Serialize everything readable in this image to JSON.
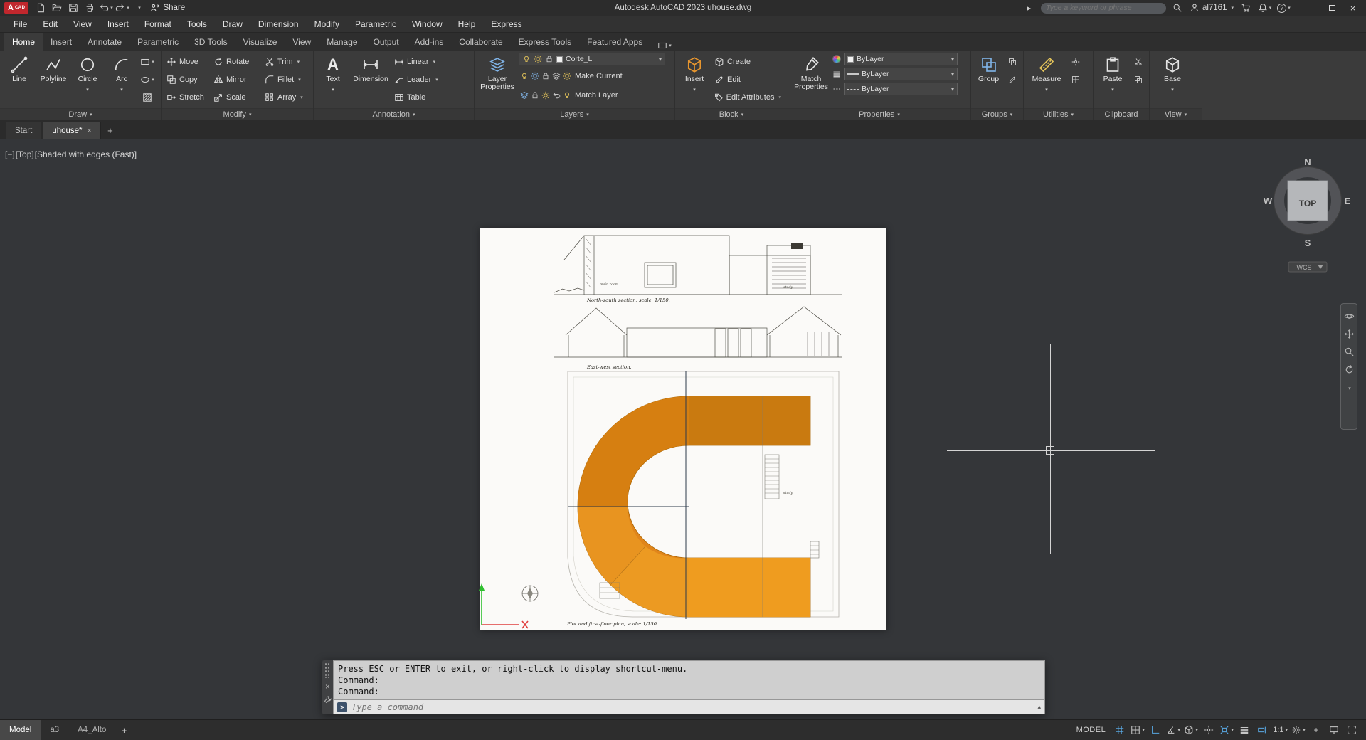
{
  "titlebar": {
    "logo_a": "A",
    "logo_cad": "CAD",
    "share_label": "Share",
    "app_title": "Autodesk AutoCAD 2023   uhouse.dwg",
    "search_placeholder": "Type a keyword or phrase",
    "username": "al7161"
  },
  "glyphs": {
    "chevron_down": "▾",
    "chevron_up": "▴",
    "chevron_right": "▸",
    "close": "×",
    "minimize": "–",
    "plus": "+",
    "prompt": ">",
    "question": "?",
    "letter_A": "A"
  },
  "menu": {
    "items": [
      "File",
      "Edit",
      "View",
      "Insert",
      "Format",
      "Tools",
      "Draw",
      "Dimension",
      "Modify",
      "Parametric",
      "Window",
      "Help",
      "Express"
    ]
  },
  "ribbon": {
    "tabs": [
      "Home",
      "Insert",
      "Annotate",
      "Parametric",
      "3D Tools",
      "Visualize",
      "View",
      "Manage",
      "Output",
      "Add-ins",
      "Collaborate",
      "Express Tools",
      "Featured Apps"
    ],
    "panel_labels": {
      "draw": "Draw",
      "modify": "Modify",
      "annotation": "Annotation",
      "layers": "Layers",
      "block": "Block",
      "properties": "Properties",
      "groups": "Groups",
      "utilities": "Utilities",
      "clipboard": "Clipboard",
      "view": "View"
    },
    "draw": {
      "line": "Line",
      "polyline": "Polyline",
      "circle": "Circle",
      "arc": "Arc"
    },
    "modify": {
      "move": "Move",
      "rotate": "Rotate",
      "trim": "Trim",
      "copy": "Copy",
      "mirror": "Mirror",
      "fillet": "Fillet",
      "stretch": "Stretch",
      "scale": "Scale",
      "array": "Array"
    },
    "annotation": {
      "text": "Text",
      "dimension": "Dimension",
      "linear": "Linear",
      "leader": "Leader",
      "table": "Table"
    },
    "layers": {
      "layer_properties": "Layer Properties",
      "current_layer": "Corte_L",
      "make_current": "Make Current",
      "match_layer": "Match Layer"
    },
    "block": {
      "insert": "Insert",
      "create": "Create",
      "edit": "Edit",
      "edit_attributes": "Edit Attributes"
    },
    "properties": {
      "match_properties": "Match Properties",
      "color": "ByLayer",
      "lineweight": "ByLayer",
      "linetype": "ByLayer"
    },
    "groups": {
      "group": "Group"
    },
    "utilities": {
      "measure": "Measure"
    },
    "clipboard": {
      "paste": "Paste"
    },
    "view_panel": {
      "base": "Base"
    }
  },
  "filetabs": {
    "start": "Start",
    "active": "uhouse*"
  },
  "viewport": {
    "collapse": "[−]",
    "view": "[Top]",
    "style": "[Shaded with edges (Fast)]"
  },
  "viewcube": {
    "n": "N",
    "e": "E",
    "s": "S",
    "w": "W",
    "face": "TOP",
    "wcs": "WCS"
  },
  "drawing": {
    "north_south_caption": "North-south section; scale:   1/150.",
    "east_west_caption": "East-west section.",
    "plan_caption": "Plot and first-floor plan; scale:   1/150.",
    "main_room": "main room",
    "study": "study"
  },
  "command": {
    "line1": "Press ESC or ENTER to exit, or right-click to display shortcut-menu.",
    "line2": "Command:",
    "line3": "Command:",
    "placeholder": "Type a command"
  },
  "statusbar": {
    "tabs": [
      "Model",
      "a3",
      "A4_Alto"
    ],
    "model_space_badge": "MODEL",
    "annotation_scale": "1:1"
  },
  "colors": {
    "accent_blue": "#58a6e0",
    "autocad_red": "#c1272d",
    "plan_orange": "#e0851b"
  }
}
